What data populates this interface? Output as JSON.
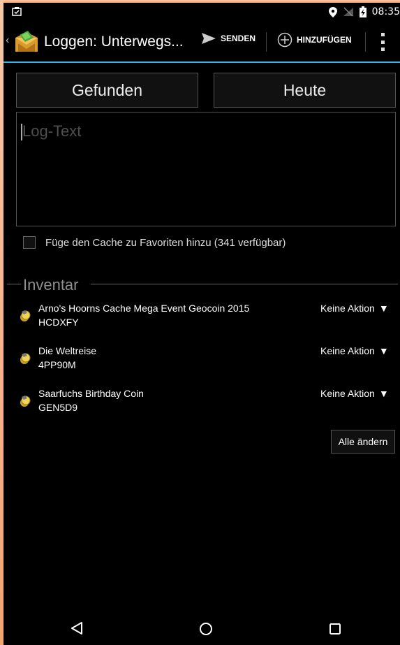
{
  "status_bar": {
    "time": "08:35",
    "icons": [
      "clipboard-icon",
      "location-icon",
      "no-signal-icon",
      "battery-charging-icon"
    ]
  },
  "action_bar": {
    "title": "Loggen: Unterwegs...",
    "send_label": "SENDEN",
    "add_label": "HINZUFÜGEN",
    "accent_color": "#35b6e6"
  },
  "form": {
    "log_type_button": "Gefunden",
    "date_button": "Heute",
    "log_text_placeholder": "Log-Text",
    "favorite_checkbox_label": "Füge den Cache zu Favoriten hinzu (341 verfügbar)",
    "favorite_checked": false
  },
  "inventory": {
    "title": "Inventar",
    "items": [
      {
        "name": "Arno's Hoorns Cache Mega Event Geocoin 2015",
        "code": "HCDXFY",
        "action": "Keine Aktion"
      },
      {
        "name": "Die Weltreise",
        "code": "4PP90M",
        "action": "Keine Aktion"
      },
      {
        "name": "Saarfuchs Birthday Coin",
        "code": "GEN5D9",
        "action": "Keine Aktion"
      }
    ],
    "change_all_button": "Alle ändern"
  },
  "nav_bar": {
    "icons": [
      "back-icon",
      "home-icon",
      "recents-icon"
    ]
  }
}
